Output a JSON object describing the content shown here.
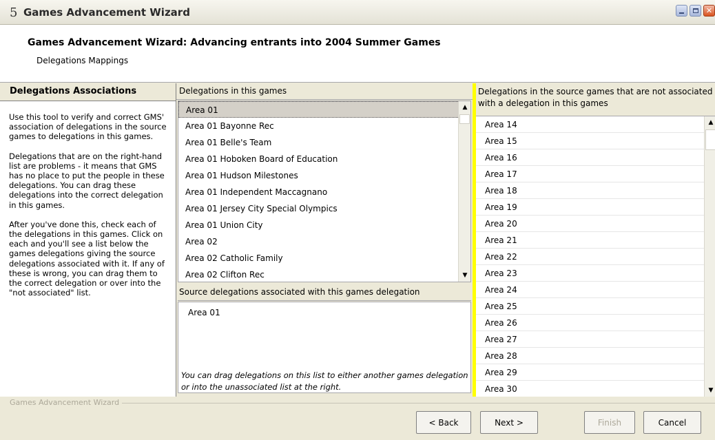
{
  "window": {
    "icon_glyph": "5",
    "title": "Games Advancement Wizard",
    "controls": [
      "minimize-icon",
      "maximize-icon",
      "close-icon"
    ]
  },
  "header": {
    "title": "Games Advancement Wizard: Advancing entrants into 2004 Summer Games",
    "subtitle": "Delegations Mappings"
  },
  "help": {
    "title": "Delegations Associations",
    "paragraphs": [
      "Use this tool to verify and correct GMS' association of delegations in the source games to delegations in this games.",
      "Delegations that are on the right-hand list are problems - it means that GMS has no place to put the people in these delegations. You can drag these delegations into the correct delegation in this games.",
      "After you've done this, check each of the delegations in this games. Click on each and you'll see a list below the games delegations giving the source delegations associated with it. If any of these is wrong, you can drag them to the correct delegation or over into the \"not associated\" list."
    ]
  },
  "games_delegations": {
    "header": "Delegations in this games",
    "selected": "Area 01",
    "items": [
      "Area 01",
      "Area 01 Bayonne Rec",
      "Area 01 Belle's Team",
      "Area 01 Hoboken Board of Education",
      "Area 01 Hudson Milestones",
      "Area 01 Independent Maccagnano",
      "Area 01 Jersey City Special Olympics",
      "Area 01 Union City",
      "Area 02",
      "Area 02 Catholic Family",
      "Area 02 Clifton Rec"
    ]
  },
  "source_delegations": {
    "header": "Source delegations associated with this games delegation",
    "items": [
      "Area 01"
    ],
    "note": "You can drag delegations on this list to either another games delegation or into the unassociated list at the right."
  },
  "unassociated": {
    "header": "Delegations in the source games that are not associated with a delegation in this games",
    "items": [
      "Area 14",
      "Area 15",
      "Area 16",
      "Area 17",
      "Area 18",
      "Area 19",
      "Area 20",
      "Area 21",
      "Area 22",
      "Area 23",
      "Area 24",
      "Area 25",
      "Area 26",
      "Area 27",
      "Area 28",
      "Area 29",
      "Area 30"
    ]
  },
  "footer": {
    "group_label": "Games Advancement Wizard",
    "back": "< Back",
    "next": "Next >",
    "finish": "Finish",
    "cancel": "Cancel"
  }
}
